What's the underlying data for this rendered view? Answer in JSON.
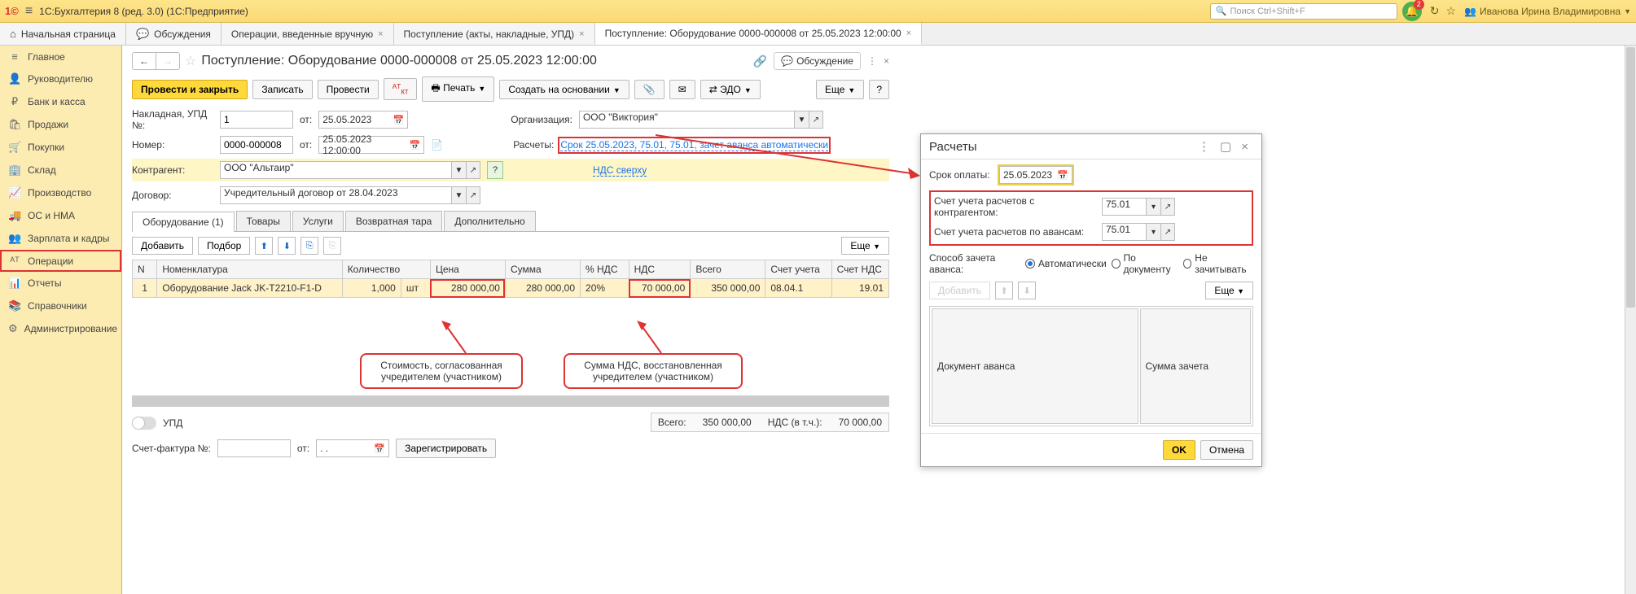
{
  "header": {
    "logo": "1©",
    "title": "1С:Бухгалтерия 8 (ред. 3.0)  (1С:Предприятие)",
    "search_placeholder": "Поиск Ctrl+Shift+F",
    "bell_badge": "2",
    "user": "Иванова Ирина Владимировна"
  },
  "tabs": [
    {
      "label": "Начальная страница",
      "icon": "home"
    },
    {
      "label": "Обсуждения",
      "icon": "chat"
    },
    {
      "label": "Операции, введенные вручную",
      "close": true
    },
    {
      "label": "Поступление (акты, накладные, УПД)",
      "close": true
    },
    {
      "label": "Поступление: Оборудование 0000-000008 от 25.05.2023 12:00:00",
      "close": true,
      "active": true
    }
  ],
  "sidebar": [
    {
      "icon": "≡",
      "label": "Главное"
    },
    {
      "icon": "👤",
      "label": "Руководителю"
    },
    {
      "icon": "₽",
      "label": "Банк и касса"
    },
    {
      "icon": "🛍",
      "label": "Продажи"
    },
    {
      "icon": "🛒",
      "label": "Покупки"
    },
    {
      "icon": "🏢",
      "label": "Склад"
    },
    {
      "icon": "📈",
      "label": "Производство"
    },
    {
      "icon": "🚚",
      "label": "ОС и НМА"
    },
    {
      "icon": "👥",
      "label": "Зарплата и кадры"
    },
    {
      "icon": "ᴬᵀ",
      "label": "Операции",
      "selected": true
    },
    {
      "icon": "📊",
      "label": "Отчеты"
    },
    {
      "icon": "📚",
      "label": "Справочники"
    },
    {
      "icon": "⚙",
      "label": "Администрирование"
    }
  ],
  "doc": {
    "title": "Поступление: Оборудование 0000-000008 от 25.05.2023 12:00:00",
    "discussion": "Обсуждение",
    "cmd": {
      "provesti_zakryt": "Провести и закрыть",
      "zapisat": "Записать",
      "provesti": "Провести",
      "pechat": "Печать",
      "sozdat": "Создать на основании",
      "edo": "ЭДО",
      "esche": "Еще",
      "help": "?"
    },
    "form": {
      "nakladnaya_lbl": "Накладная, УПД №:",
      "nakladnaya_no": "1",
      "ot1": "от:",
      "nakladnaya_date": "25.05.2023",
      "org_lbl": "Организация:",
      "org": "ООО \"Виктория\"",
      "nomer_lbl": "Номер:",
      "nomer": "0000-000008",
      "ot2": "от:",
      "nomer_date": "25.05.2023 12:00:00",
      "raschety_lbl": "Расчеты:",
      "raschety_link": "Срок 25.05.2023, 75.01, 75.01, зачет аванса автоматически",
      "kontragent_lbl": "Контрагент:",
      "kontragent": "ООО \"Альтаир\"",
      "nds_link": "НДС сверху",
      "dogovor_lbl": "Договор:",
      "dogovor": "Учредительный договор от 28.04.2023"
    },
    "itabs": [
      {
        "label": "Оборудование (1)",
        "active": true
      },
      {
        "label": "Товары"
      },
      {
        "label": "Услуги"
      },
      {
        "label": "Возвратная тара"
      },
      {
        "label": "Дополнительно"
      }
    ],
    "tblbar": {
      "dobavit": "Добавить",
      "podbor": "Подбор",
      "esche": "Еще"
    },
    "table": {
      "headers": [
        "N",
        "Номенклатура",
        "Количество",
        "Цена",
        "Сумма",
        "% НДС",
        "НДС",
        "Всего",
        "Счет учета",
        "Счет НДС"
      ],
      "row": {
        "n": "1",
        "nomen": "Оборудование Jack JK-T2210-F1-D",
        "qty": "1,000",
        "unit": "шт",
        "price": "280 000,00",
        "sum": "280 000,00",
        "pct": "20%",
        "nds": "70 000,00",
        "total": "350 000,00",
        "schet": "08.04.1",
        "schet_nds": "19.01"
      }
    },
    "annot1": "Стоимость, согласованная учредителем (участником)",
    "annot2": "Сумма НДС, восстановленная учредителем (участником)",
    "upd_lbl": "УПД",
    "totals": {
      "vsego_lbl": "Всего:",
      "vsego": "350 000,00",
      "nds_lbl": "НДС (в т.ч.):",
      "nds": "70 000,00"
    },
    "sf": {
      "lbl": "Счет-фактура №:",
      "ot": "от:",
      "date": ".  .",
      "reg": "Зарегистрировать"
    }
  },
  "popup": {
    "title": "Расчеты",
    "srok_lbl": "Срок оплаты:",
    "srok": "25.05.2023",
    "sch1_lbl": "Счет учета расчетов с контрагентом:",
    "sch1": "75.01",
    "sch2_lbl": "Счет учета расчетов по авансам:",
    "sch2": "75.01",
    "sposob_lbl": "Способ зачета аванса:",
    "radio": [
      "Автоматически",
      "По документу",
      "Не зачитывать"
    ],
    "dobavit": "Добавить",
    "esche": "Еще",
    "cols": [
      "Документ аванса",
      "Сумма зачета"
    ],
    "ok": "OK",
    "cancel": "Отмена"
  }
}
